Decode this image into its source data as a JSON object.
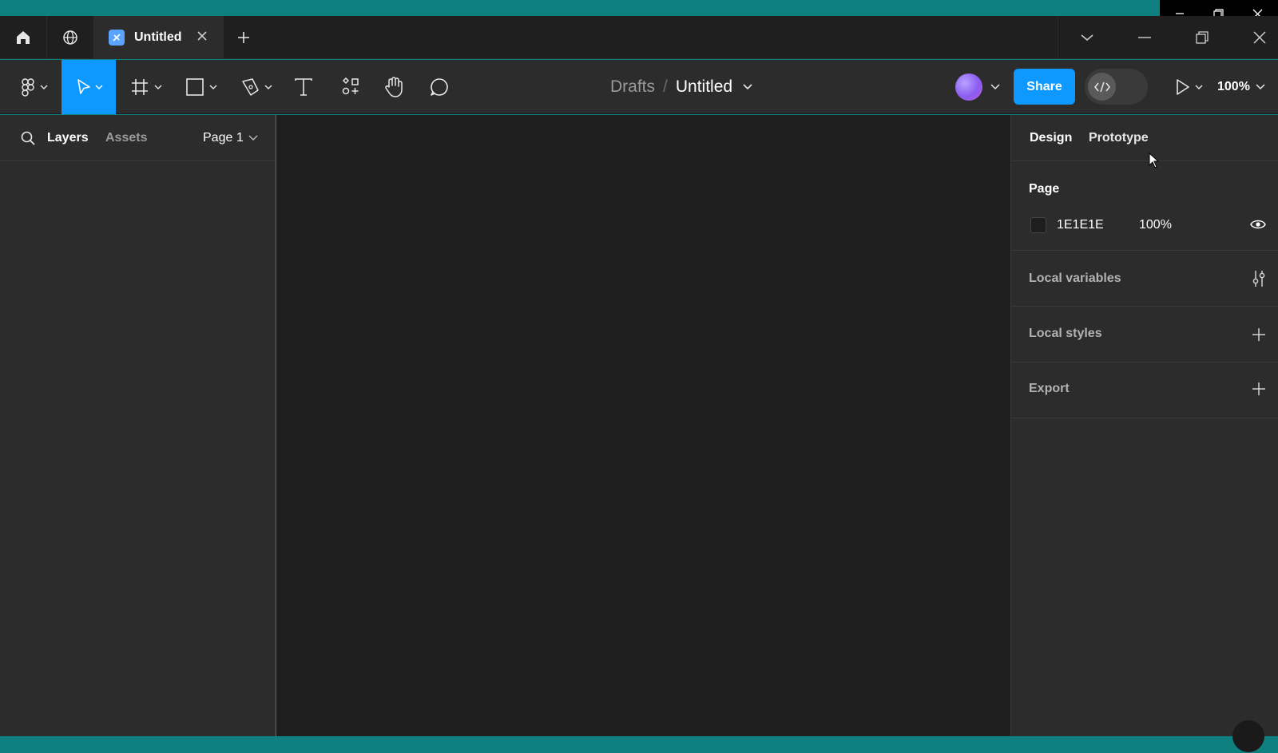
{
  "colors": {
    "frame": "#0e8080",
    "accent": "#0d99ff",
    "panel": "#2c2c2c",
    "canvas": "#1e1e1e"
  },
  "tabbar": {
    "home_icon": "home-icon",
    "community_icon": "globe-icon",
    "active_tab": {
      "title": "Untitled",
      "icon": "figma-file-icon",
      "close_icon": "close-icon"
    },
    "new_tab_icon": "plus-icon",
    "right": {
      "tabs_menu_icon": "chevron-down-icon",
      "minimize_icon": "minimize-icon",
      "restore_icon": "restore-icon",
      "close_icon": "close-icon"
    }
  },
  "toolbar": {
    "main_menu_icon": "figma-logo-icon",
    "tools": [
      {
        "name": "move-tool",
        "icon": "cursor-arrow-icon",
        "active": true
      },
      {
        "name": "frame-tool",
        "icon": "frame-hash-icon"
      },
      {
        "name": "shape-tool",
        "icon": "rectangle-icon"
      },
      {
        "name": "pen-tool",
        "icon": "pen-icon"
      },
      {
        "name": "text-tool",
        "icon": "text-icon"
      },
      {
        "name": "resources-tool",
        "icon": "components-icon"
      },
      {
        "name": "hand-tool",
        "icon": "hand-icon"
      },
      {
        "name": "comment-tool",
        "icon": "comment-icon"
      }
    ],
    "breadcrumb": {
      "folder": "Drafts",
      "separator": "/",
      "file": "Untitled"
    },
    "share_label": "Share",
    "dev_mode_icon": "code-icon",
    "present_icon": "play-icon",
    "zoom": "100%"
  },
  "left_panel": {
    "search_icon": "search-icon",
    "tabs": [
      "Layers",
      "Assets"
    ],
    "page": "Page 1"
  },
  "right_panel": {
    "tabs": [
      "Design",
      "Prototype"
    ],
    "page_section": {
      "title": "Page",
      "color_hex": "1E1E1E",
      "opacity": "100%",
      "visibility_icon": "eye-icon"
    },
    "local_variables": {
      "title": "Local variables",
      "icon": "sliders-icon"
    },
    "local_styles": {
      "title": "Local styles",
      "icon": "plus-icon"
    },
    "export": {
      "title": "Export",
      "icon": "plus-icon"
    }
  },
  "os_caption": {
    "minimize_icon": "minimize-icon",
    "restore_icon": "restore-icon",
    "close_icon": "close-icon"
  }
}
